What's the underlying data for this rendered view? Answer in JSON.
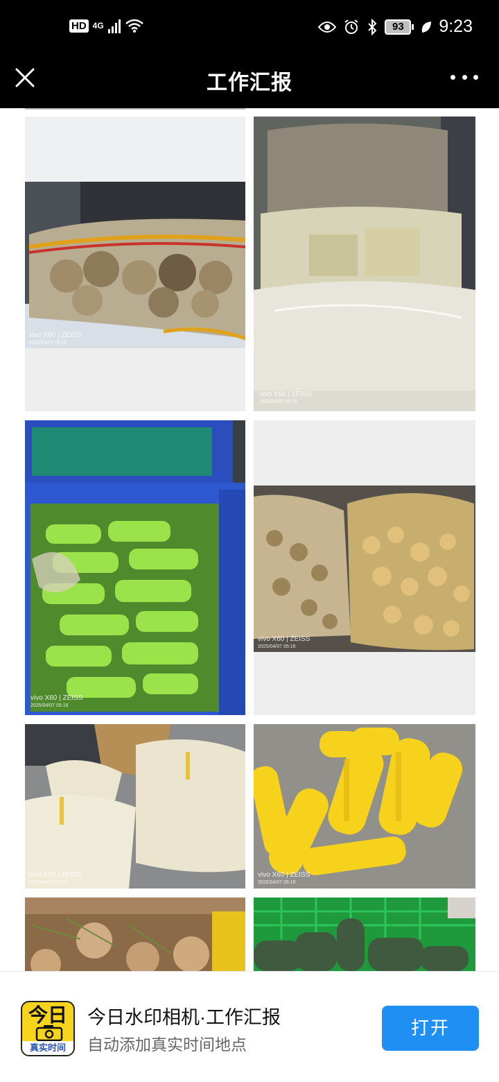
{
  "status_bar": {
    "hd": "HD",
    "network": "4G",
    "battery": "93",
    "time": "9:23"
  },
  "header": {
    "title": "工作汇报"
  },
  "photos": [
    {
      "watermark": "vivo X60 | ZEISS",
      "date": "2025/04/07 05:15"
    },
    {
      "watermark": "vivo X60 | ZEISS",
      "date": "2025/04/07 05:15"
    },
    {
      "watermark": "vivo X60 | ZEISS",
      "date": "2025/04/07 05:16"
    },
    {
      "watermark": "vivo X60 | ZEISS",
      "date": "2025/04/07 05:16"
    },
    {
      "watermark": "vivo X60 | ZEISS",
      "date": "2025/04/07 05:16"
    },
    {
      "watermark": "vivo X60 | ZEISS",
      "date": "2025/04/07 05:15"
    },
    {
      "watermark": "",
      "date": ""
    },
    {
      "watermark": "",
      "date": ""
    }
  ],
  "banner": {
    "logo_big": "今日",
    "logo_small": "真实时间",
    "title": "今日水印相机·工作汇报",
    "subtitle": "自动添加真实时间地点",
    "open_label": "打开"
  },
  "colors": {
    "accent": "#1f8ff4",
    "logo_yellow": "#f7d41c"
  }
}
